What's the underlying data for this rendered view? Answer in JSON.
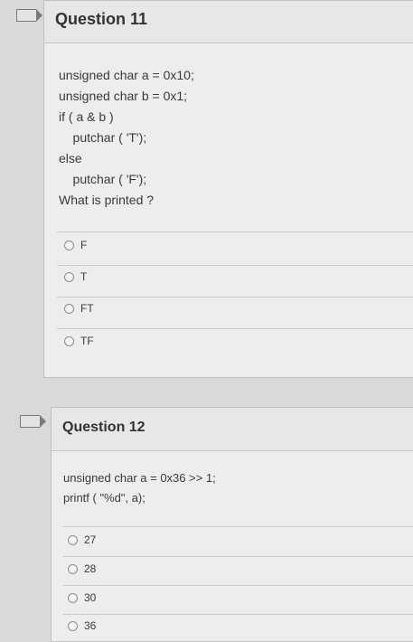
{
  "questions": [
    {
      "title": "Question 11",
      "code": [
        "unsigned char a = 0x10;",
        "unsigned char b = 0x1;",
        "if ( a & b )",
        "    putchar ( 'T');",
        "else",
        "    putchar ( 'F');",
        "What is printed ?"
      ],
      "options": [
        "F",
        "T",
        "FT",
        "TF"
      ]
    },
    {
      "title": "Question 12",
      "code": [
        "unsigned char a = 0x36 >> 1;",
        "printf ( \"%d\", a);"
      ],
      "options": [
        "27",
        "28",
        "30",
        "36"
      ]
    }
  ],
  "colors": {
    "background": "#d7d9da",
    "card": "#eceded",
    "header": "#e6e7e8"
  },
  "icons": {
    "flag": "flag-icon",
    "radio": "radio-button-icon"
  }
}
